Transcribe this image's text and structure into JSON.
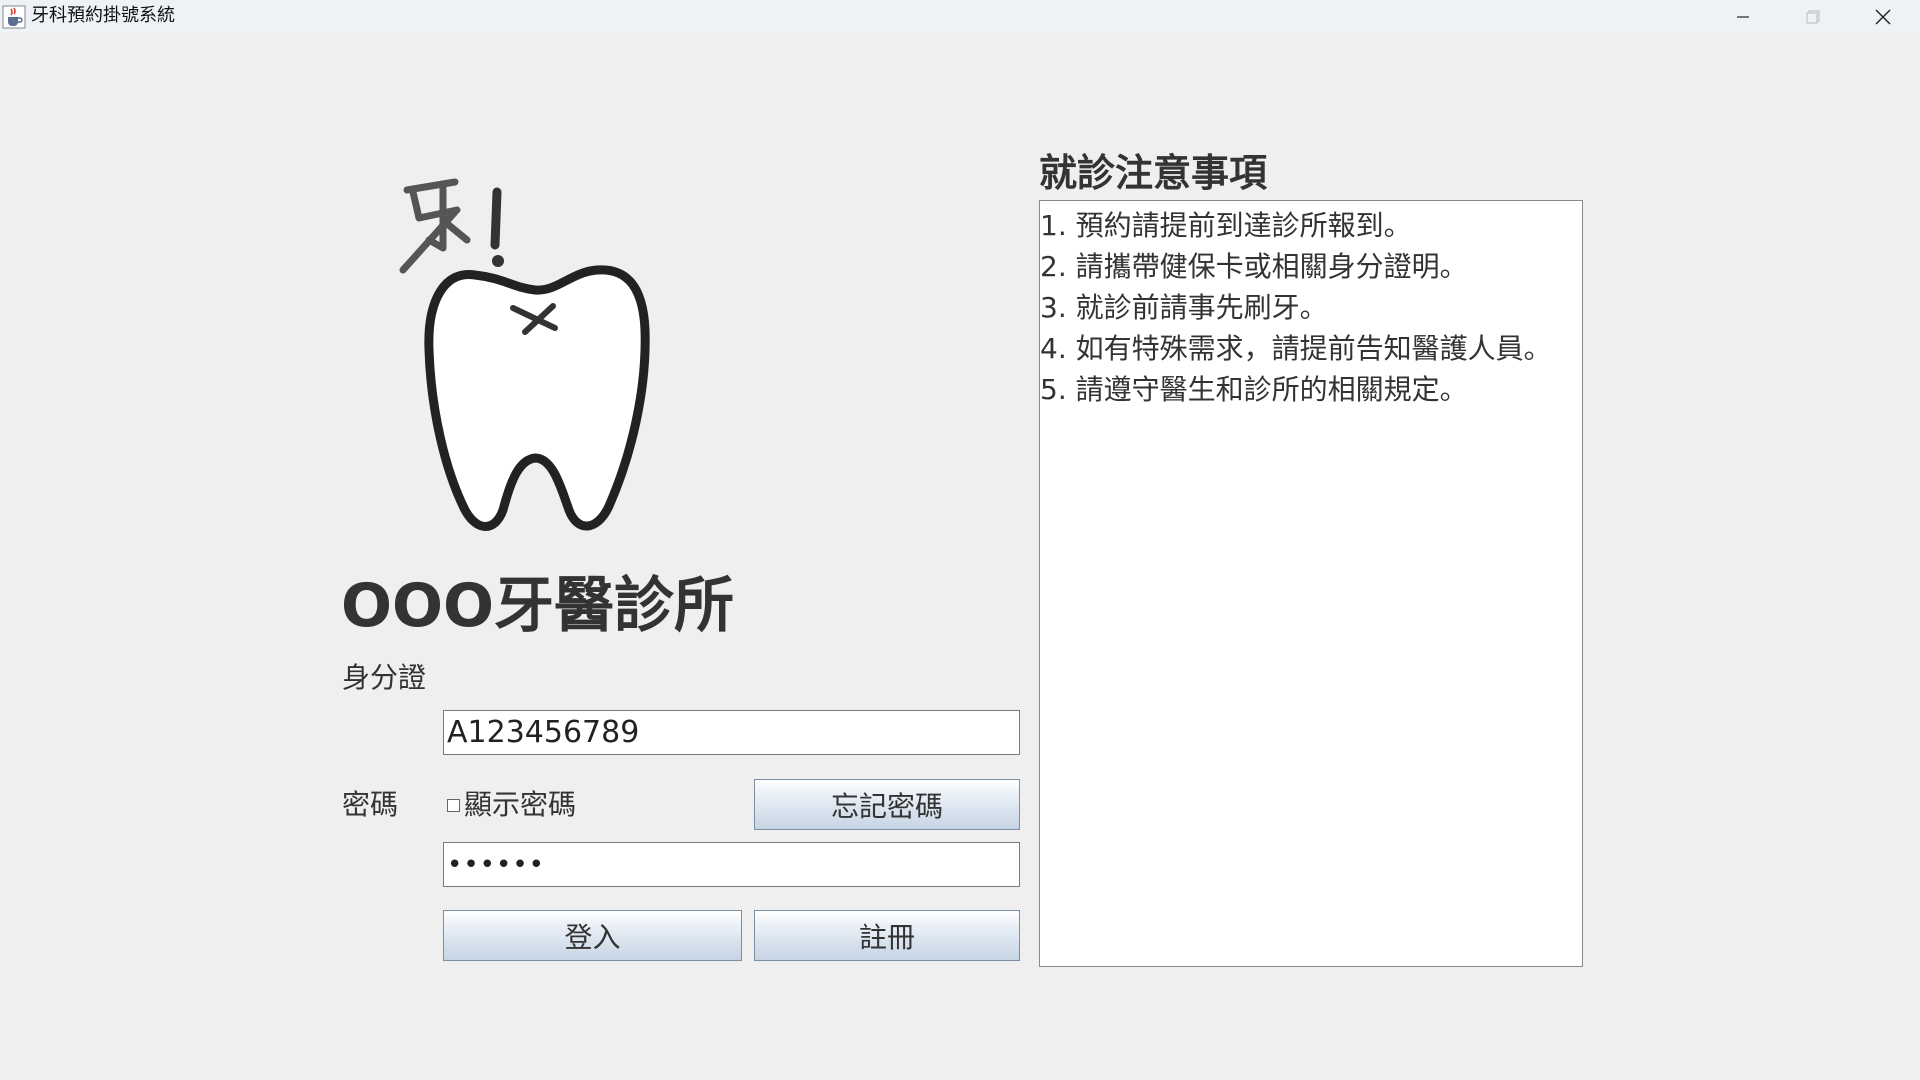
{
  "window": {
    "title": "牙科預約掛號系統",
    "icon": "java-cup-icon"
  },
  "clinic": {
    "name": "OOO牙醫診所",
    "logo_text": "牙!"
  },
  "login": {
    "id_label": "身分證",
    "id_value": "A123456789",
    "password_label": "密碼",
    "show_password_label": "顯示密碼",
    "show_password_checked": false,
    "password_masked": "••••••",
    "forgot_password_button": "忘記密碼",
    "login_button": "登入",
    "register_button": "註冊"
  },
  "notice": {
    "title": "就診注意事項",
    "lines": [
      "1. 預約請提前到達診所報到。",
      "2. 請攜帶健保卡或相關身分證明。",
      "3. 就診前請事先刷牙。",
      "4. 如有特殊需求，請提前告知醫護人員。",
      "5. 請遵守醫生和診所的相關規定。"
    ]
  }
}
